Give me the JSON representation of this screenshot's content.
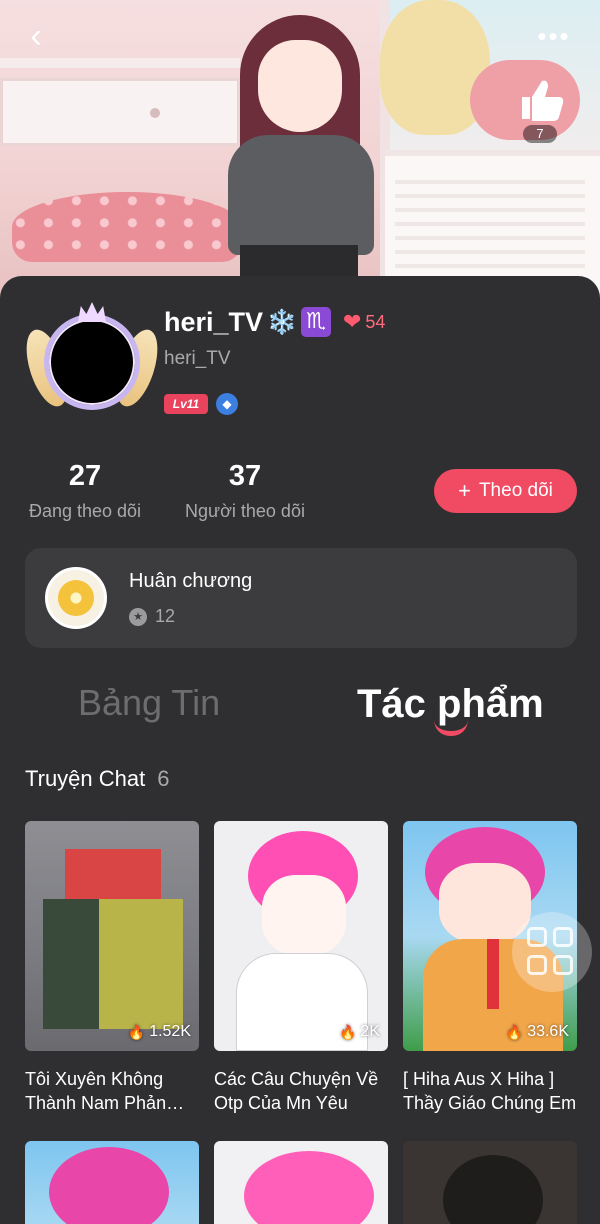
{
  "header": {
    "back_icon": "chevron-left-icon",
    "more_icon": "more-dots-icon",
    "more_label": "•••",
    "like_icon": "thumbs-up-icon",
    "like_count": "7"
  },
  "profile": {
    "display_name": "heri_TV",
    "name_emoji_1": "❄️",
    "name_emoji_2": "♏",
    "hearts_icon": "hearts-icon",
    "hearts_count": "54",
    "handle": "heri_TV",
    "level_badge": "Lv11",
    "verified_icon": "verified-badge-icon"
  },
  "stats": {
    "following_count": "27",
    "following_label": "Đang theo dõi",
    "followers_count": "37",
    "followers_label": "Người theo dõi"
  },
  "follow_button": {
    "icon": "plus-icon",
    "label": "Theo dõi",
    "color": "#f04b63"
  },
  "medals": {
    "title": "Huân chương",
    "count_icon": "star-icon",
    "count": "12"
  },
  "tabs": [
    {
      "label": "Bảng Tin",
      "active": false
    },
    {
      "label": "Tác phẩm",
      "active": true
    }
  ],
  "section": {
    "title": "Truyện Chat",
    "count": "6"
  },
  "stories": [
    {
      "title": "Tôi Xuyên Không Thành Nam Phản Diện",
      "views": "1.52K"
    },
    {
      "title": "Các Câu Chuyện Về Otp Của Mn Yêu",
      "views": "2K"
    },
    {
      "title": "[ Hiha Aus X Hiha ] Thầy Giáo Chúng Em",
      "views": "33.6K"
    }
  ],
  "floating_button": {
    "icon": "apps-grid-icon"
  },
  "colors": {
    "background": "#2f2f31",
    "card": "#3c3c3e",
    "accent": "#f04b63",
    "muted_text": "#a9a9ab"
  }
}
